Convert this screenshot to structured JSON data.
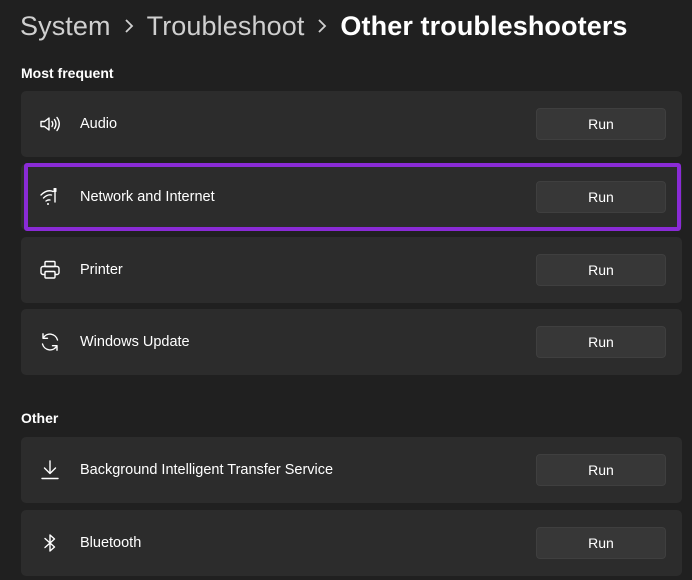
{
  "breadcrumb": {
    "items": [
      "System",
      "Troubleshoot",
      "Other troubleshooters"
    ]
  },
  "sections": {
    "most_frequent": {
      "title": "Most frequent",
      "items": [
        {
          "label": "Audio",
          "icon": "speaker-icon",
          "button": "Run"
        },
        {
          "label": "Network and Internet",
          "icon": "wifi-icon",
          "button": "Run"
        },
        {
          "label": "Printer",
          "icon": "printer-icon",
          "button": "Run"
        },
        {
          "label": "Windows Update",
          "icon": "sync-icon",
          "button": "Run"
        }
      ]
    },
    "other": {
      "title": "Other",
      "items": [
        {
          "label": "Background Intelligent Transfer Service",
          "icon": "download-icon",
          "button": "Run"
        },
        {
          "label": "Bluetooth",
          "icon": "bluetooth-icon",
          "button": "Run"
        }
      ]
    }
  },
  "colors": {
    "background": "#202020",
    "card": "#2c2c2c",
    "button": "#373737",
    "highlight": "#8a2bd6"
  }
}
